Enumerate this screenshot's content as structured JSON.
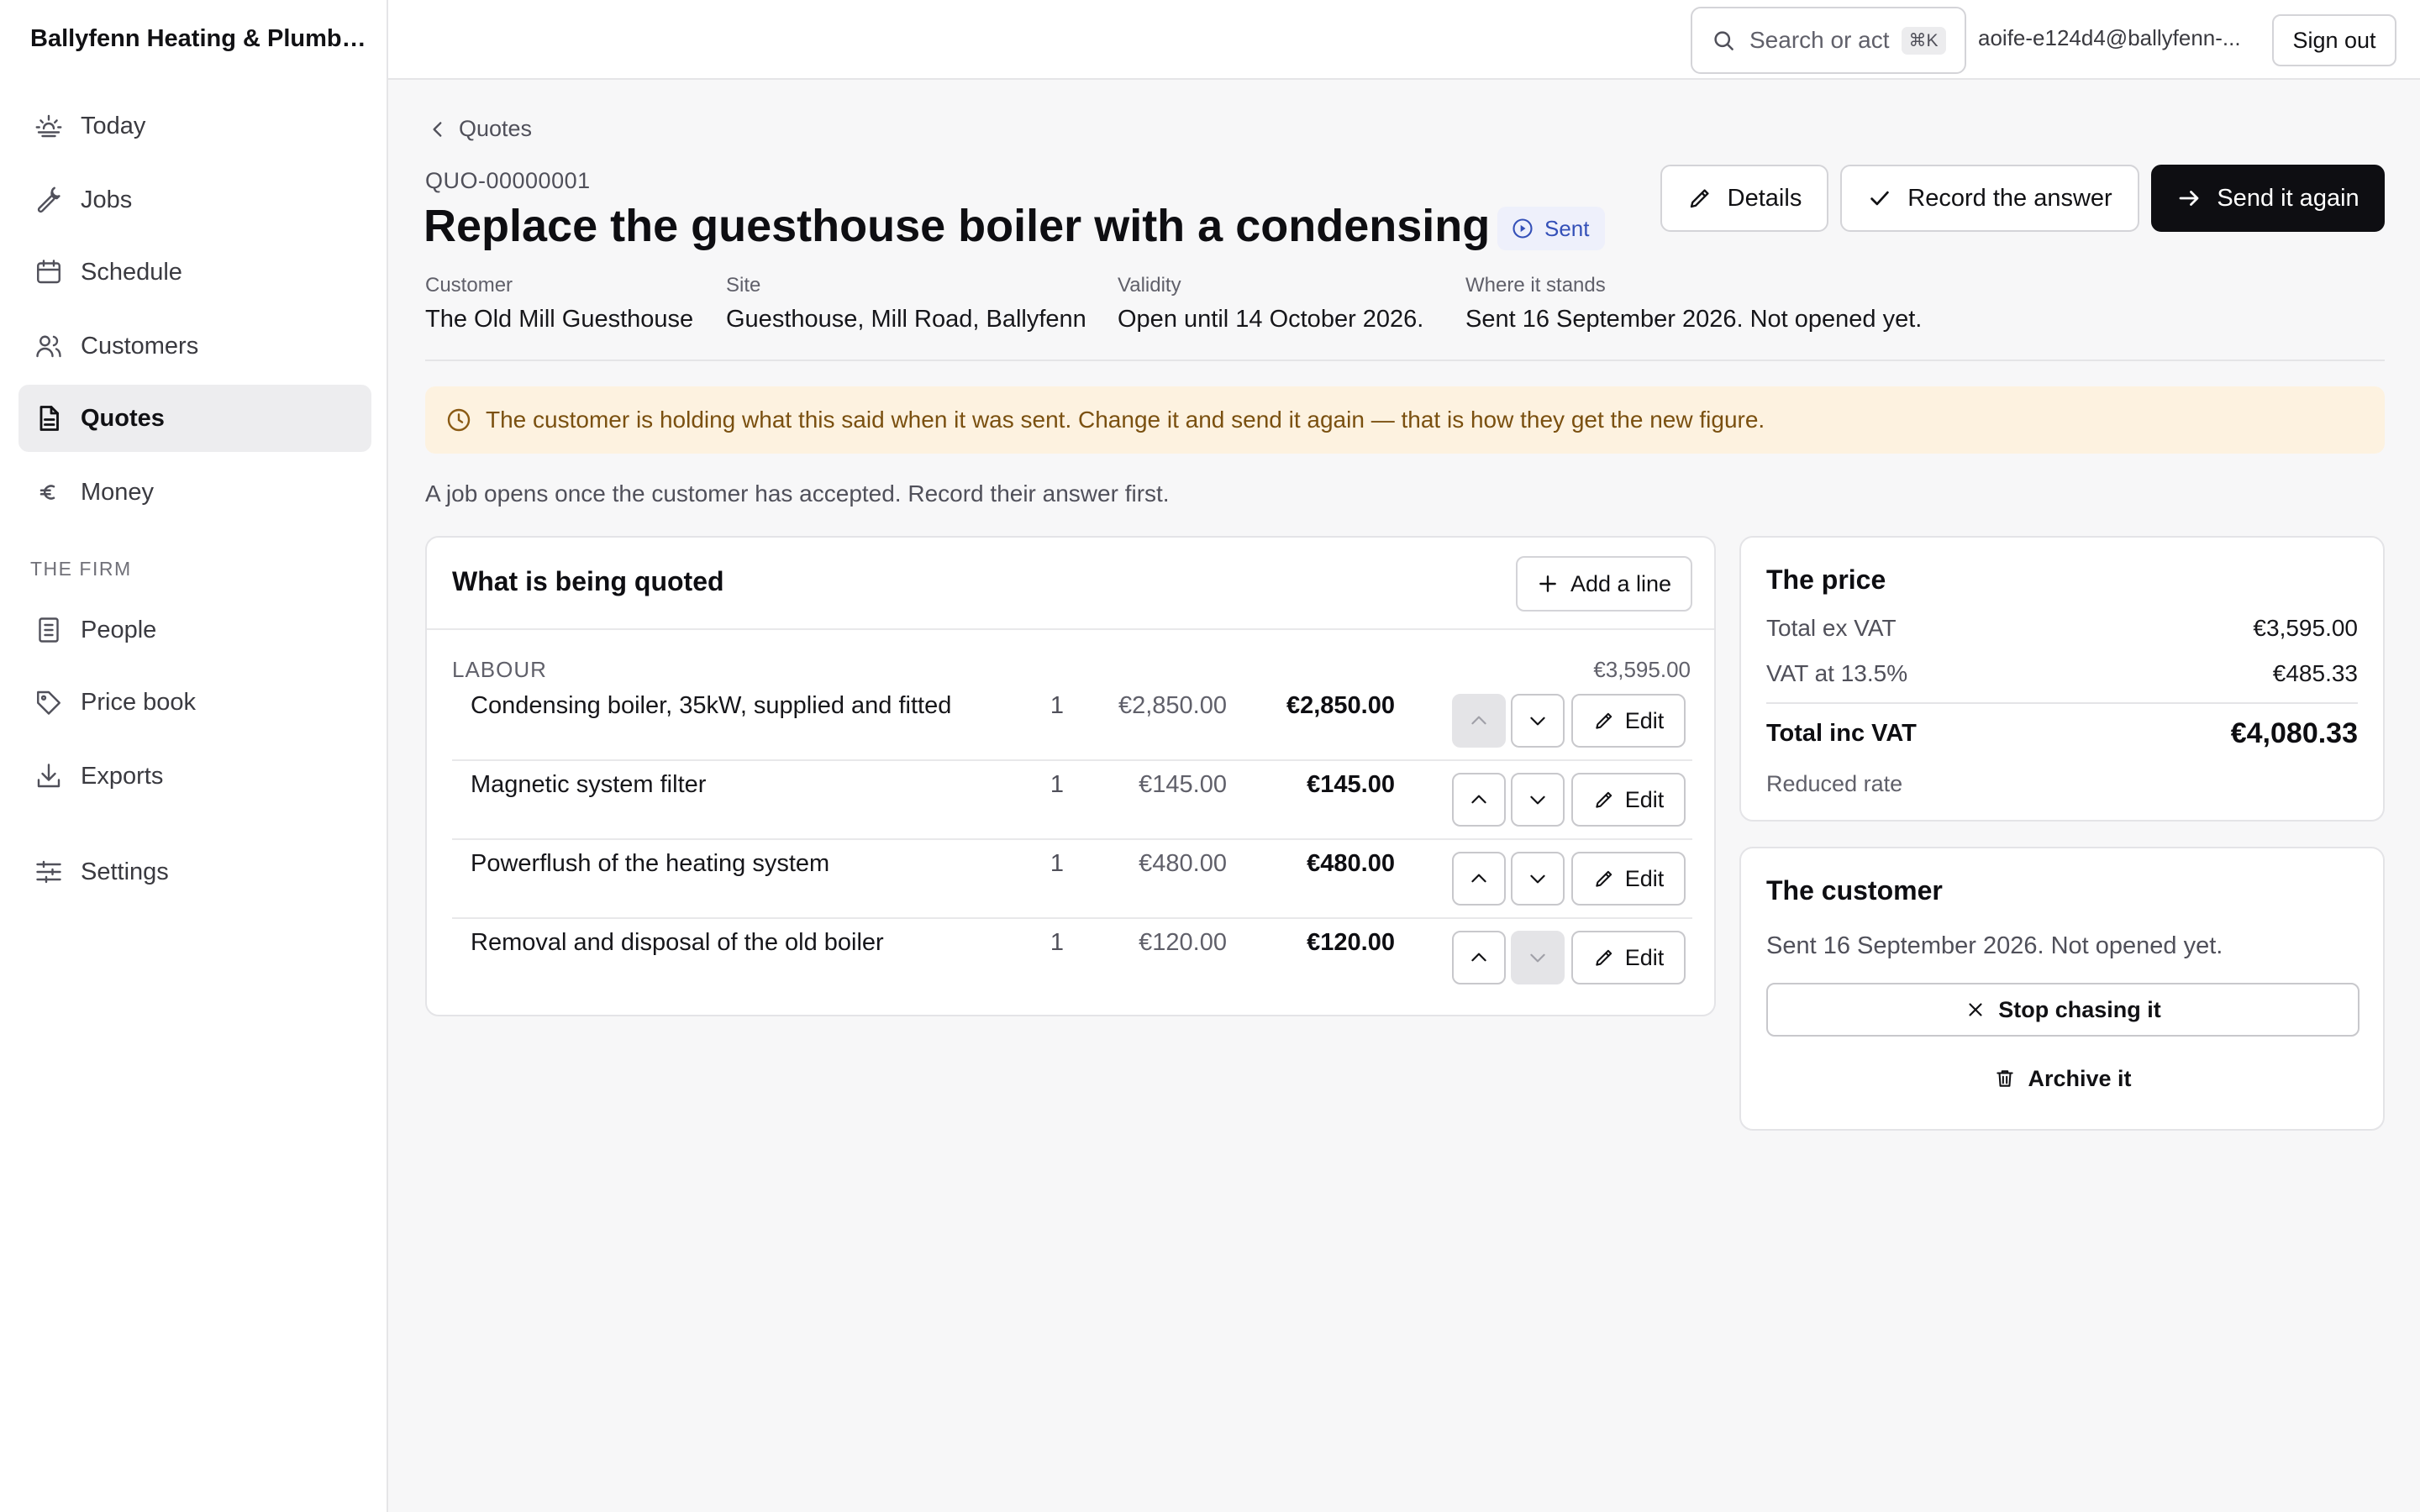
{
  "app": {
    "company": "Ballyfenn Heating & Plumbi...",
    "user_email": "aoife-e124d4@ballyfenn-...",
    "sign_out": "Sign out",
    "search": {
      "placeholder": "Search or act",
      "shortcut": "⌘K"
    }
  },
  "sidebar": {
    "items": [
      {
        "label": "Today",
        "icon": "sunrise-icon"
      },
      {
        "label": "Jobs",
        "icon": "wrench-icon"
      },
      {
        "label": "Schedule",
        "icon": "calendar-icon"
      },
      {
        "label": "Customers",
        "icon": "users-icon"
      },
      {
        "label": "Quotes",
        "icon": "document-icon",
        "active": true
      },
      {
        "label": "Money",
        "icon": "euro-icon"
      }
    ],
    "section_label": "THE FIRM",
    "firm_items": [
      {
        "label": "People",
        "icon": "ledger-icon"
      },
      {
        "label": "Price book",
        "icon": "tag-icon"
      },
      {
        "label": "Exports",
        "icon": "download-icon"
      }
    ],
    "settings": {
      "label": "Settings",
      "icon": "sliders-icon"
    }
  },
  "quote": {
    "back_label": "Quotes",
    "reference": "QUO-00000001",
    "title": "Replace the guesthouse boiler with a condensing unit",
    "status": "Sent",
    "actions": {
      "details": "Details",
      "record": "Record the answer",
      "send_again": "Send it again"
    },
    "meta": [
      {
        "label": "Customer",
        "value": "The Old Mill Guesthouse"
      },
      {
        "label": "Site",
        "value": "Guesthouse, Mill Road, Ballyfenn"
      },
      {
        "label": "Validity",
        "value": "Open until 14 October 2026."
      },
      {
        "label": "Where it stands",
        "value": "Sent 16 September 2026. Not opened yet."
      }
    ],
    "notice": "The customer is holding what this said when it was sent. Change it and send it again — that is how they get the new figure.",
    "hint": "A job opens once the customer has accepted. Record their answer first."
  },
  "lines": {
    "title": "What is being quoted",
    "add_label": "Add a line",
    "group": {
      "name": "LABOUR",
      "total": "€3,595.00"
    },
    "edit_label": "Edit",
    "rows": [
      {
        "description": "Condensing boiler, 35kW, supplied and fitted",
        "qty": "1",
        "unit_price": "€2,850.00",
        "total": "€2,850.00",
        "up_enabled": false,
        "down_enabled": true
      },
      {
        "description": "Magnetic system filter",
        "qty": "1",
        "unit_price": "€145.00",
        "total": "€145.00",
        "up_enabled": true,
        "down_enabled": true
      },
      {
        "description": "Powerflush of the heating system",
        "qty": "1",
        "unit_price": "€480.00",
        "total": "€480.00",
        "up_enabled": true,
        "down_enabled": true
      },
      {
        "description": "Removal and disposal of the old boiler",
        "qty": "1",
        "unit_price": "€120.00",
        "total": "€120.00",
        "up_enabled": true,
        "down_enabled": false
      }
    ]
  },
  "price": {
    "title": "The price",
    "ex_vat_label": "Total ex VAT",
    "ex_vat": "€3,595.00",
    "vat_label": "VAT at 13.5%",
    "vat": "€485.33",
    "inc_vat_label": "Total inc VAT",
    "inc_vat": "€4,080.33",
    "note": "Reduced rate"
  },
  "customer_panel": {
    "title": "The customer",
    "status": "Sent 16 September 2026. Not opened yet.",
    "stop_label": "Stop chasing it",
    "archive_label": "Archive it"
  }
}
